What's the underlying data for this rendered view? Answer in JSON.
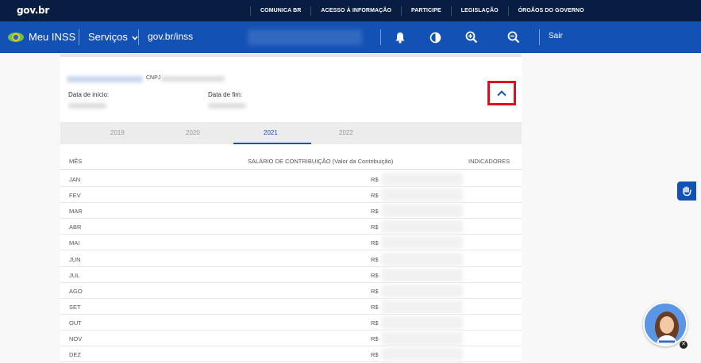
{
  "topbar": {
    "logo": "gov.br",
    "links": [
      "COMUNICA BR",
      "ACESSO À INFORMAÇÃO",
      "PARTICIPE",
      "LEGISLAÇÃO",
      "ÓRGÃOS DO GOVERNO"
    ]
  },
  "header": {
    "app_name": "Meu INSS",
    "servicos": "Serviços",
    "govbr_link": "gov.br/inss",
    "sair": "Sair",
    "icons": [
      "bell-icon",
      "contrast-icon",
      "zoom-in-icon",
      "zoom-out-icon"
    ]
  },
  "employer": {
    "cnpj_label": "CNPJ",
    "start_label": "Data de início:",
    "end_label": "Data de fim:"
  },
  "tabs": {
    "years": [
      "2019",
      "2020",
      "2021",
      "2022"
    ],
    "active": "2021"
  },
  "table": {
    "col_month": "MÊS",
    "col_salary": "SALÁRIO DE CONTRIBUIÇÃO (Valor da Contribuição)",
    "col_indicators": "INDICADORES",
    "currency": "R$",
    "months": [
      "JAN",
      "FEV",
      "MAR",
      "ABR",
      "MAI",
      "JUN",
      "JUL",
      "AGO",
      "SET",
      "OUT",
      "NOV",
      "DEZ"
    ]
  },
  "colors": {
    "topbar": "#071d41",
    "header": "#1351b4",
    "highlight": "#e20d1d"
  }
}
